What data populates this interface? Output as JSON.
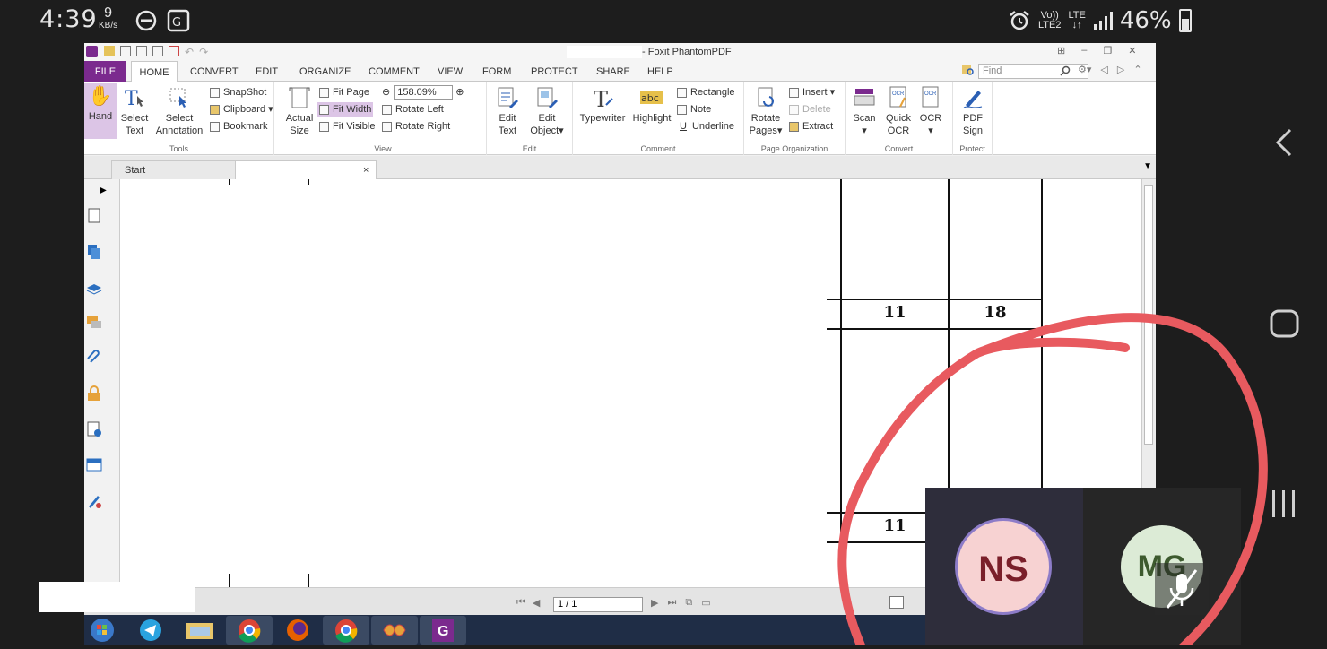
{
  "status_bar": {
    "time": "4:39",
    "speed_value": "9",
    "speed_unit": "KB/s",
    "network_volte": "Vo))",
    "network_lte2": "LTE2",
    "network_lte": "LTE",
    "battery": "46%"
  },
  "app": {
    "title": "- Foxit PhantomPDF",
    "ribbon_tabs": [
      "FILE",
      "HOME",
      "CONVERT",
      "EDIT",
      "ORGANIZE",
      "COMMENT",
      "VIEW",
      "FORM",
      "PROTECT",
      "SHARE",
      "HELP"
    ],
    "find_placeholder": "Find",
    "tools": {
      "hand": "Hand",
      "select_text_1": "Select",
      "select_text_2": "Text",
      "select_ann_1": "Select",
      "select_ann_2": "Annotation",
      "snapshot": "SnapShot",
      "clipboard": "Clipboard",
      "bookmark": "Bookmark",
      "label": "Tools"
    },
    "view": {
      "actual_1": "Actual",
      "actual_2": "Size",
      "fit_page": "Fit Page",
      "fit_width": "Fit Width",
      "fit_visible": "Fit Visible",
      "zoom": "158.09%",
      "rotate_left": "Rotate Left",
      "rotate_right": "Rotate Right",
      "label": "View"
    },
    "edit": {
      "edit_text_1": "Edit",
      "edit_text_2": "Text",
      "edit_obj_1": "Edit",
      "edit_obj_2": "Object",
      "label": "Edit"
    },
    "comment": {
      "typewriter": "Typewriter",
      "highlight": "Highlight",
      "rectangle": "Rectangle",
      "note": "Note",
      "underline": "Underline",
      "label": "Comment"
    },
    "page_org": {
      "rotate_1": "Rotate",
      "rotate_2": "Pages",
      "insert": "Insert",
      "delete": "Delete",
      "extract": "Extract",
      "label": "Page Organization"
    },
    "convert": {
      "scan": "Scan",
      "quick_ocr_1": "Quick",
      "quick_ocr_2": "OCR",
      "ocr": "OCR",
      "label": "Convert"
    },
    "protect": {
      "pdf_sign_1": "PDF",
      "pdf_sign_2": "Sign",
      "label": "Protect"
    },
    "doc_tabs": {
      "start": "Start",
      "close": "×"
    },
    "page_indicator": "1 / 1"
  },
  "document": {
    "cells": [
      "11",
      "18",
      "11"
    ]
  },
  "meeting": {
    "participant1_initials": "NS",
    "participant2_initials": "MG"
  },
  "colors": {
    "file_tab": "#7b2a8e",
    "annotation_red": "#e85a5f",
    "ns_avatar": "#f7d2d2",
    "mg_avatar": "#dcebd6"
  }
}
